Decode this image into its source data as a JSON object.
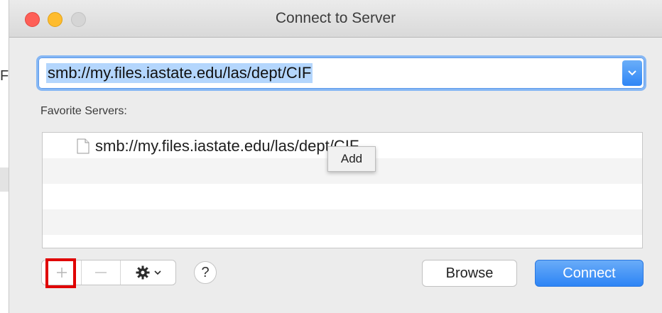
{
  "window": {
    "title": "Connect to Server"
  },
  "background": {
    "partial_letter": "F"
  },
  "server_address": {
    "value": "smb://my.files.iastate.edu/las/dept/CIF"
  },
  "favorites": {
    "label": "Favorite Servers:",
    "items": [
      {
        "text": "smb://my.files.iastate.edu/las/dept/CIF",
        "icon": "document-icon"
      }
    ]
  },
  "tooltip": {
    "text": "Add"
  },
  "toolbar": {
    "add_label": "+",
    "remove_label": "—",
    "action_icon": "gear-icon",
    "help_label": "?"
  },
  "buttons": {
    "browse": "Browse",
    "connect": "Connect"
  },
  "colors": {
    "accent": "#2d84f5",
    "highlight_box": "#e00000",
    "selection": "#b4d6fd"
  }
}
